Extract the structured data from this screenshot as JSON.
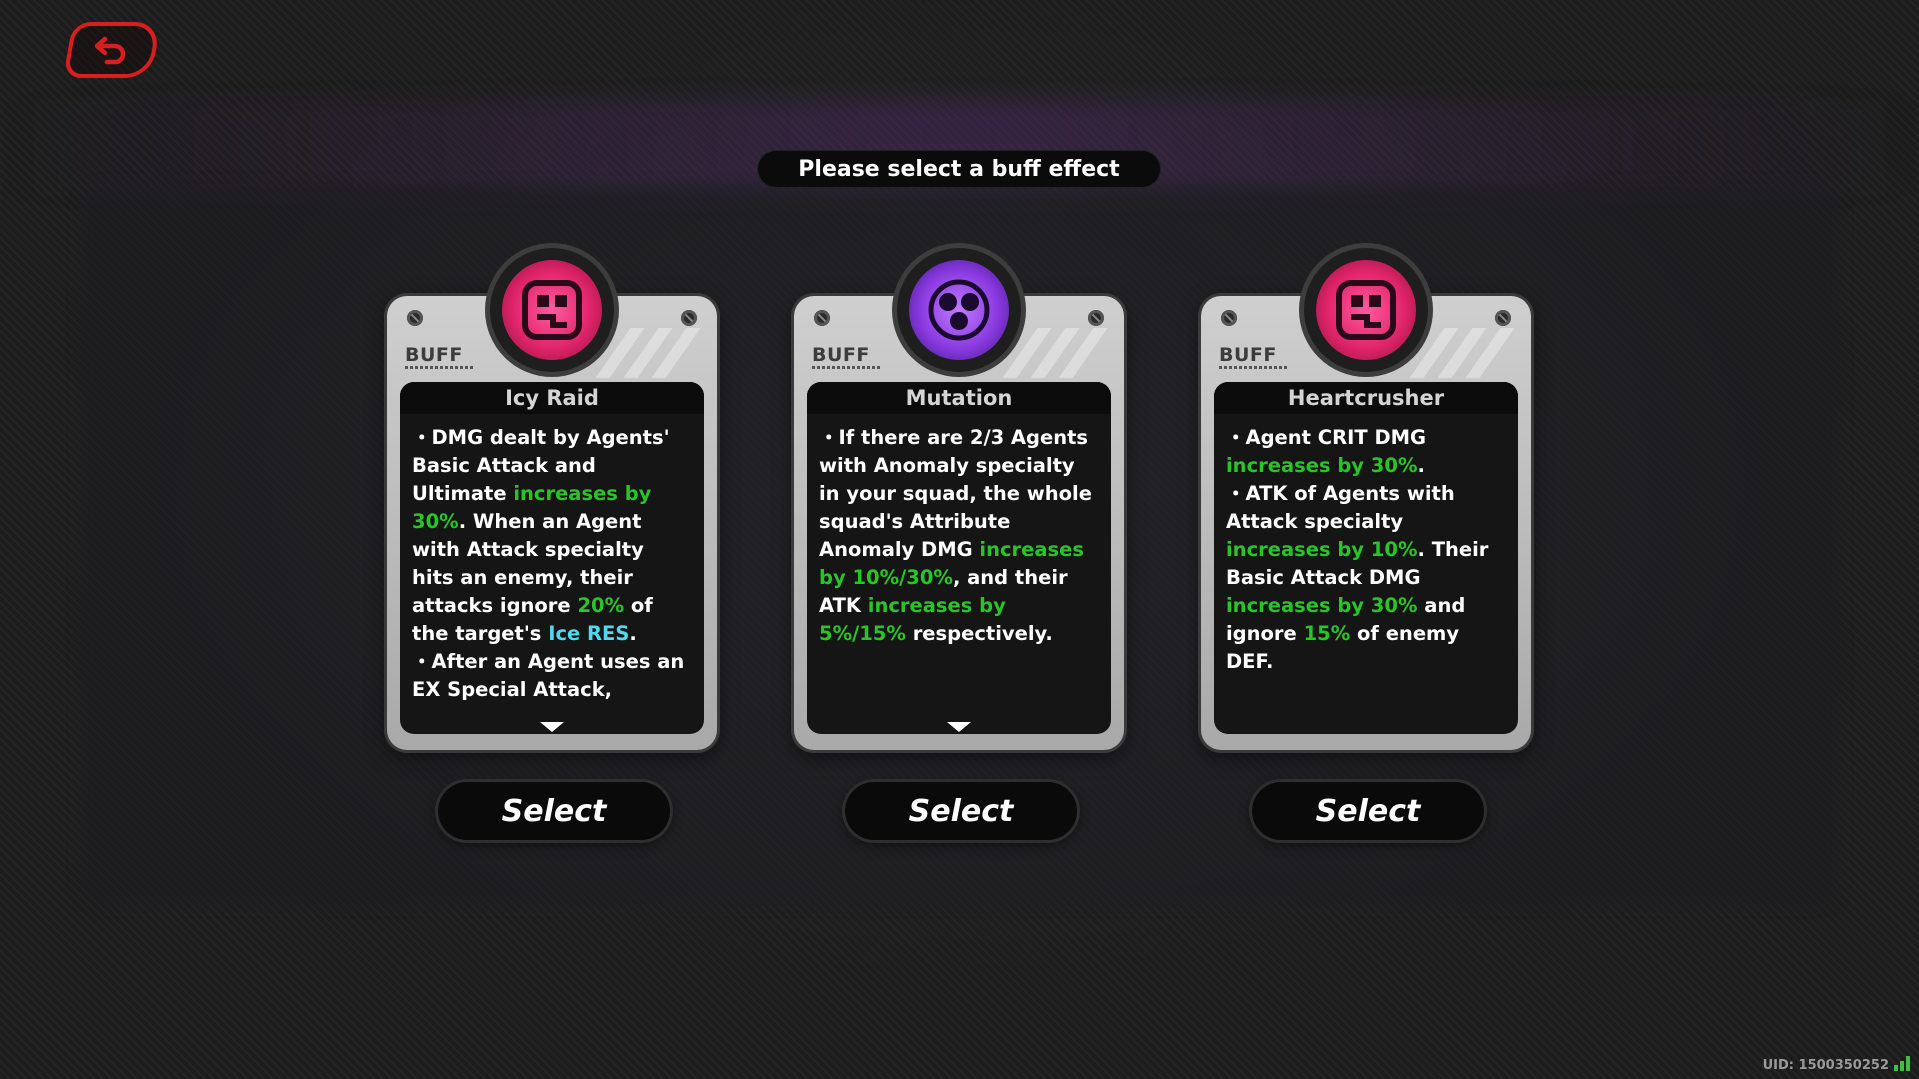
{
  "header": {
    "prompt": "Please select a buff effect"
  },
  "cards": [
    {
      "tag": "BUFF",
      "title": "Icy Raid",
      "emblem_color": "#e0246a",
      "select_label": "Select",
      "desc": [
        {
          "t": "・DMG dealt by Agents' Basic Attack and Ultimate "
        },
        {
          "t": "increases by 30%",
          "c": "g"
        },
        {
          "t": ". When an Agent with Attack specialty hits an enemy, their attacks ignore "
        },
        {
          "t": "20%",
          "c": "g"
        },
        {
          "t": " of the target's "
        },
        {
          "t": "Ice RES",
          "c": "c"
        },
        {
          "t": ".\n・After an Agent uses an EX Special Attack,"
        }
      ]
    },
    {
      "tag": "BUFF",
      "title": "Mutation",
      "emblem_color": "#8a3ae0",
      "select_label": "Select",
      "desc": [
        {
          "t": "・If there are 2/3 Agents with Anomaly specialty in your squad, the whole squad's Attribute Anomaly DMG "
        },
        {
          "t": "increases by 10%/30%",
          "c": "g"
        },
        {
          "t": ", and their ATK "
        },
        {
          "t": "increases by 5%/15%",
          "c": "g"
        },
        {
          "t": " respectively."
        }
      ]
    },
    {
      "tag": "BUFF",
      "title": "Heartcrusher",
      "emblem_color": "#e0246a",
      "select_label": "Select",
      "desc": [
        {
          "t": "・Agent CRIT DMG "
        },
        {
          "t": "increases by 30%",
          "c": "g"
        },
        {
          "t": ".\n・ATK of Agents with Attack specialty "
        },
        {
          "t": "increases by 10%",
          "c": "g"
        },
        {
          "t": ". Their Basic Attack DMG "
        },
        {
          "t": "increases by 30%",
          "c": "g"
        },
        {
          "t": " and ignore "
        },
        {
          "t": "15%",
          "c": "g"
        },
        {
          "t": " of enemy DEF."
        }
      ]
    }
  ],
  "footer": {
    "uid": "UID: 1500350252"
  },
  "icons": {
    "back": "back-arrow-icon",
    "emblem_1": "circuit-emblem-icon",
    "emblem_2": "triad-emblem-icon",
    "emblem_3": "circuit-emblem-icon",
    "signal": "signal-icon"
  }
}
